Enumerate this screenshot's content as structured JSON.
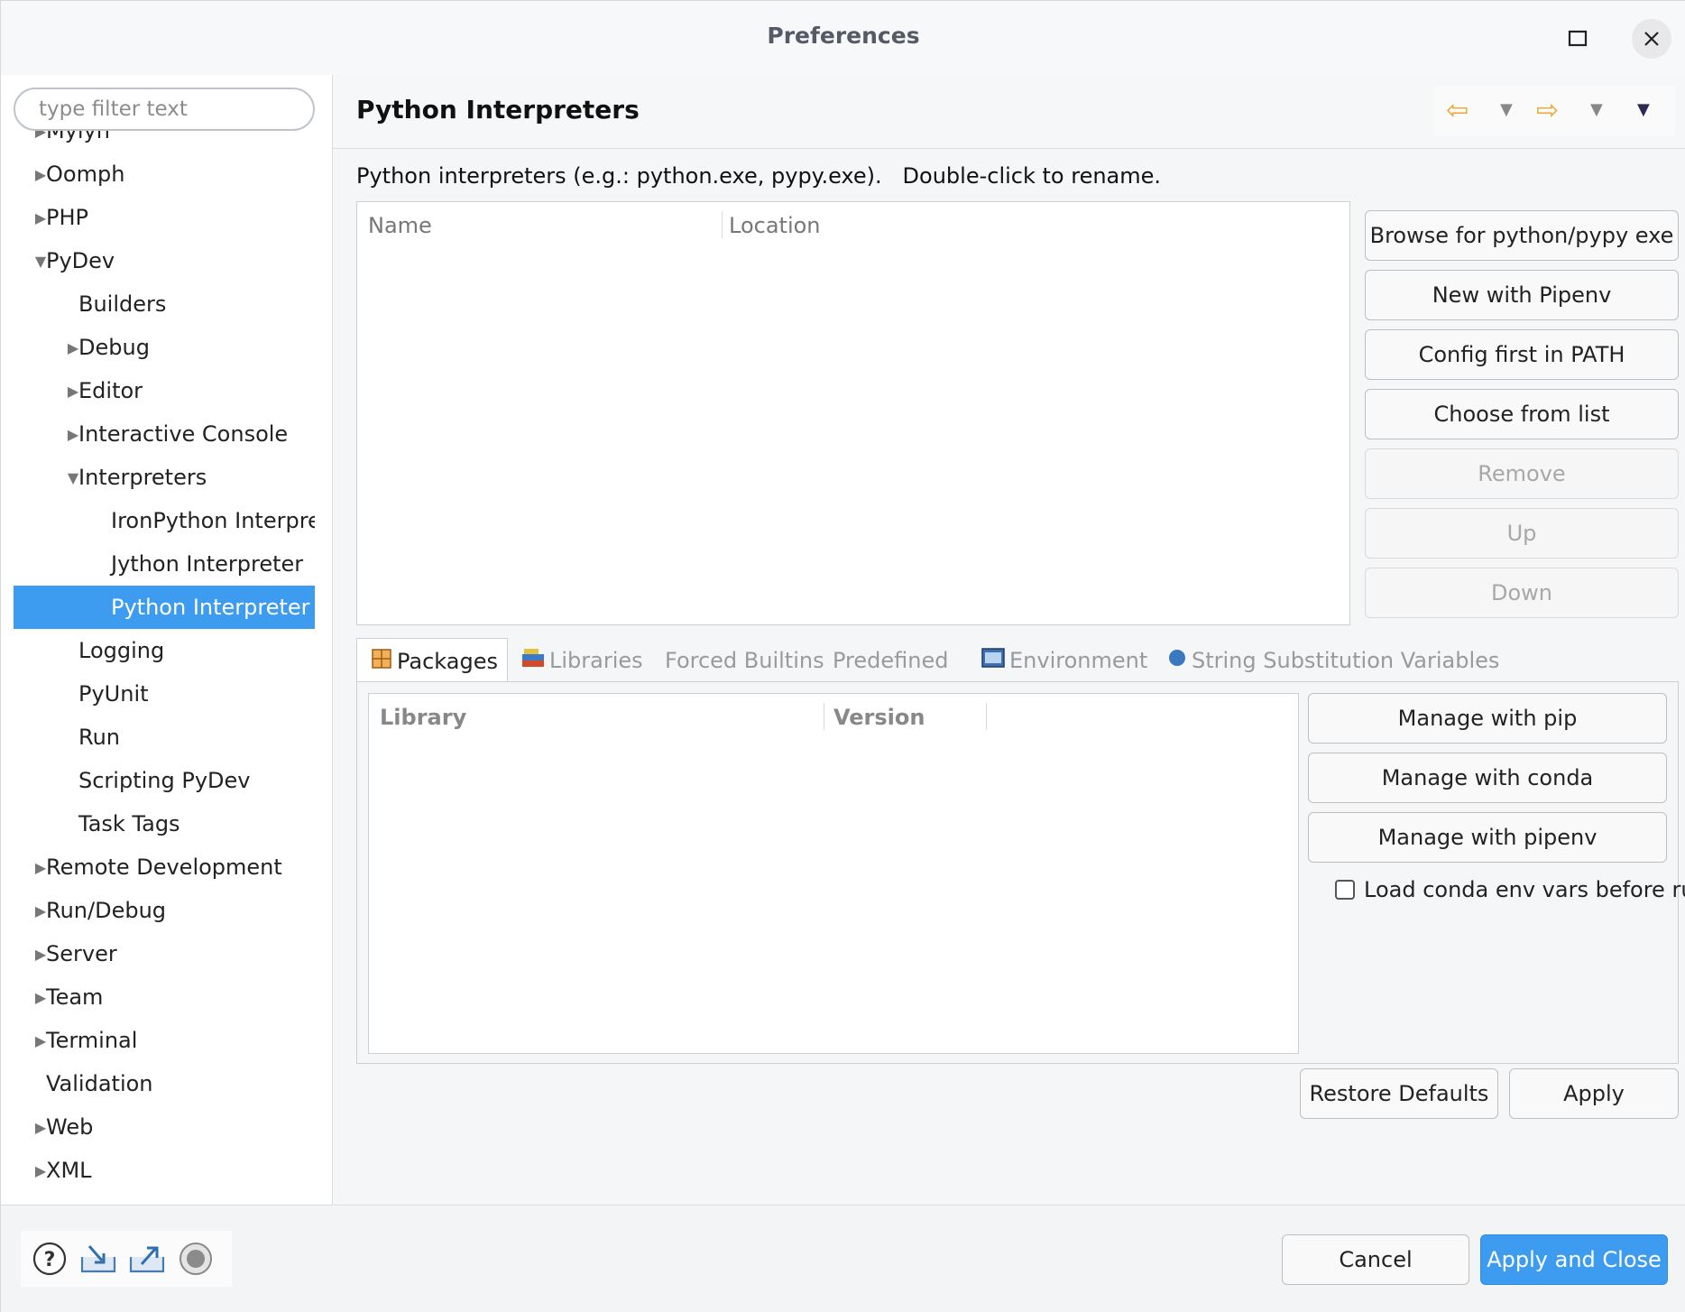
{
  "window": {
    "title": "Preferences"
  },
  "filter": {
    "placeholder": "type filter text"
  },
  "tree": [
    {
      "label": "Mylyn",
      "level": 0,
      "expander": "collapsed"
    },
    {
      "label": "Oomph",
      "level": 0,
      "expander": "collapsed"
    },
    {
      "label": "PHP",
      "level": 0,
      "expander": "collapsed"
    },
    {
      "label": "PyDev",
      "level": 0,
      "expander": "expanded"
    },
    {
      "label": "Builders",
      "level": 1,
      "expander": "none"
    },
    {
      "label": "Debug",
      "level": 1,
      "expander": "collapsed"
    },
    {
      "label": "Editor",
      "level": 1,
      "expander": "collapsed"
    },
    {
      "label": "Interactive Console",
      "level": 1,
      "expander": "collapsed"
    },
    {
      "label": "Interpreters",
      "level": 1,
      "expander": "expanded"
    },
    {
      "label": "IronPython Interpreter",
      "level": 2,
      "expander": "none"
    },
    {
      "label": "Jython Interpreter",
      "level": 2,
      "expander": "none"
    },
    {
      "label": "Python Interpreter",
      "level": 2,
      "expander": "none",
      "selected": true
    },
    {
      "label": "Logging",
      "level": 1,
      "expander": "none"
    },
    {
      "label": "PyUnit",
      "level": 1,
      "expander": "none"
    },
    {
      "label": "Run",
      "level": 1,
      "expander": "none"
    },
    {
      "label": "Scripting PyDev",
      "level": 1,
      "expander": "none"
    },
    {
      "label": "Task Tags",
      "level": 1,
      "expander": "none"
    },
    {
      "label": "Remote Development",
      "level": 0,
      "expander": "collapsed"
    },
    {
      "label": "Run/Debug",
      "level": 0,
      "expander": "collapsed"
    },
    {
      "label": "Server",
      "level": 0,
      "expander": "collapsed"
    },
    {
      "label": "Team",
      "level": 0,
      "expander": "collapsed"
    },
    {
      "label": "Terminal",
      "level": 0,
      "expander": "collapsed"
    },
    {
      "label": "Validation",
      "level": 0,
      "expander": "none"
    },
    {
      "label": "Web",
      "level": 0,
      "expander": "collapsed"
    },
    {
      "label": "XML",
      "level": 0,
      "expander": "collapsed"
    }
  ],
  "page": {
    "title": "Python Interpreters",
    "description": "Python interpreters (e.g.: python.exe, pypy.exe).   Double-click to rename."
  },
  "interpreters_table": {
    "columns": [
      "Name",
      "Location"
    ]
  },
  "interpreter_buttons": [
    {
      "label": "Browse for python/pypy exe",
      "enabled": true
    },
    {
      "label": "New with Pipenv",
      "enabled": true
    },
    {
      "label": "Config first in PATH",
      "enabled": true
    },
    {
      "label": "Choose from list",
      "enabled": true
    },
    {
      "label": "Remove",
      "enabled": false
    },
    {
      "label": "Up",
      "enabled": false
    },
    {
      "label": "Down",
      "enabled": false
    }
  ],
  "tabs": [
    {
      "label": "Packages",
      "icon": "packages-icon",
      "active": true
    },
    {
      "label": "Libraries",
      "icon": "libraries-icon",
      "active": false
    },
    {
      "label": "Forced Builtins",
      "icon": "",
      "active": false
    },
    {
      "label": "Predefined",
      "icon": "",
      "active": false
    },
    {
      "label": "Environment",
      "icon": "environment-icon",
      "active": false
    },
    {
      "label": "String Substitution Variables",
      "icon": "variables-icon",
      "active": false
    }
  ],
  "packages_table": {
    "columns": [
      "Library",
      "Version"
    ]
  },
  "package_buttons": [
    {
      "label": "Manage with pip"
    },
    {
      "label": "Manage with conda"
    },
    {
      "label": "Manage with pipenv"
    }
  ],
  "conda_checkbox": {
    "label": "Load conda env vars before run?",
    "checked": false
  },
  "page_actions": {
    "restore_defaults": "Restore Defaults",
    "apply": "Apply"
  },
  "dialog_actions": {
    "cancel": "Cancel",
    "apply_and_close": "Apply and Close"
  },
  "colors": {
    "accent": "#3d9cf0",
    "nav_arrow": "#e8a830"
  }
}
